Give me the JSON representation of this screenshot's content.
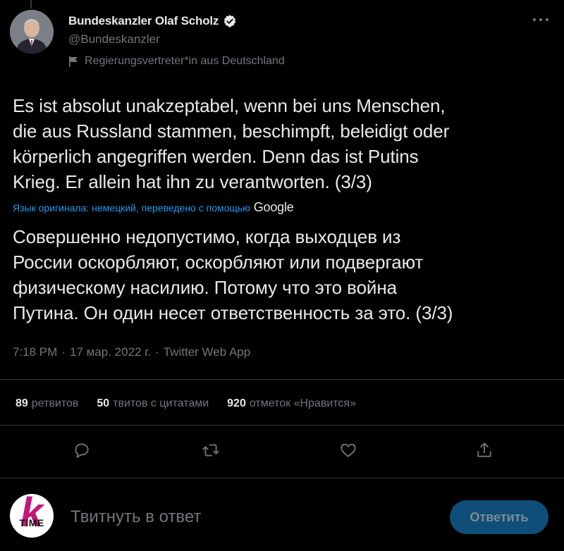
{
  "author": {
    "name": "Bundeskanzler Olaf Scholz",
    "handle": "@Bundeskanzler",
    "label": "Regierungsvertreter*in aus Deutschland"
  },
  "tweet": {
    "text": "Es ist absolut unakzeptabel, wenn bei uns Menschen,\ndie aus Russland stammen, beschimpft, beleidigt oder\nkörperlich angegriffen werden. Denn das ist Putins\nKrieg. Er allein hat ihn zu verantworten. (3/3)",
    "translation_label": "Язык оригинала: немецкий, переведено с помощью",
    "translation_provider": "Google",
    "translated_text": "Совершенно недопустимо, когда выходцев из\nРоссии оскорбляют, оскорбляют или подвергают\nфизическому насилию. Потому что это война\nПутина. Он один несет ответственность за это. (3/3)",
    "time": "7:18 PM",
    "date": "17 мар. 2022 г.",
    "source": "Twitter Web App",
    "separator": "·"
  },
  "stats": {
    "retweets_count": "89",
    "retweets_label": "ретвитов",
    "quotes_count": "50",
    "quotes_label": "твитов с цитатами",
    "likes_count": "920",
    "likes_label": "отметок «Нравится»"
  },
  "icons": {
    "reply": "reply-icon",
    "retweet": "retweet-icon",
    "like": "heart-icon",
    "share": "share-icon",
    "verified": "verified-badge-icon",
    "more": "more-icon",
    "label": "flag-icon"
  },
  "reply_box": {
    "avatar_letter": "k",
    "avatar_text": "TIME",
    "placeholder": "Твитнуть в ответ",
    "button_label": "Ответить"
  },
  "colors": {
    "background": "#000000",
    "text": "#e7e9ea",
    "muted": "#71767b",
    "accent": "#1d9bf0",
    "reply_button_bg": "#0f4e78",
    "divider": "#2f3336"
  }
}
